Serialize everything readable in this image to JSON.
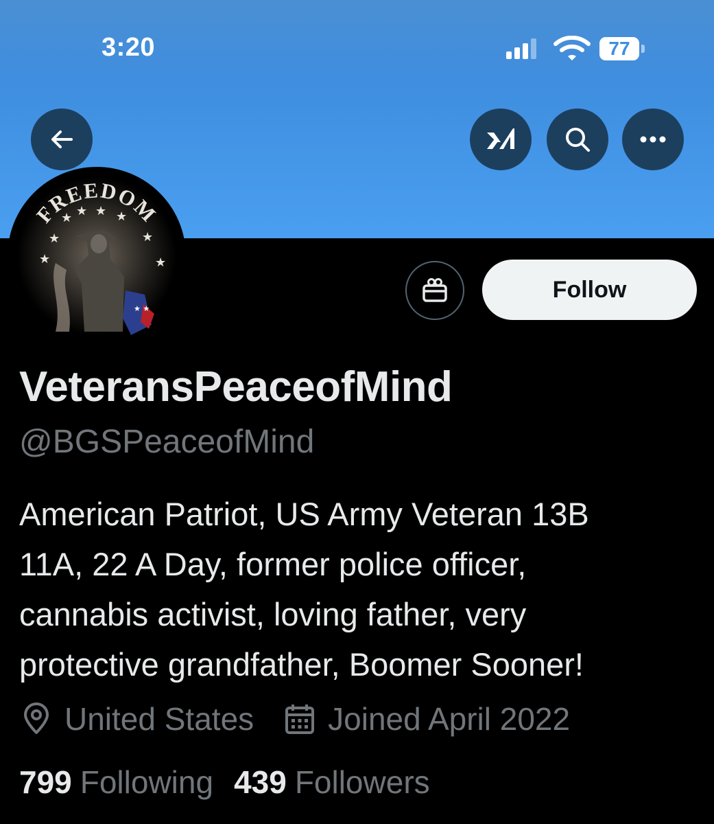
{
  "status_bar": {
    "time": "3:20",
    "battery": "77"
  },
  "header": {
    "back_icon": "arrow-left-icon",
    "grok_icon": "grok-icon",
    "search_icon": "search-icon",
    "more_icon": "more-horizontal-icon"
  },
  "avatar": {
    "text": "FREEDOM"
  },
  "actions": {
    "gift_icon": "gift-icon",
    "follow_label": "Follow"
  },
  "profile": {
    "display_name": "VeteransPeaceofMind",
    "handle": "@BGSPeaceofMind",
    "bio_lines": [
      "American Patriot, US Army Veteran 13B",
      "11A, 22 A Day, former police officer,",
      "cannabis activist, loving father, very",
      "protective grandfather, Boomer Sooner!"
    ],
    "location": "United States",
    "joined": "Joined April 2022",
    "following_count": "799",
    "following_label": "Following",
    "followers_count": "439",
    "followers_label": "Followers"
  },
  "colors": {
    "banner": "#4a9ff0",
    "header_button": "#1d3f5e",
    "follow_button": "#eff3f4",
    "secondary_text": "#71767b"
  }
}
